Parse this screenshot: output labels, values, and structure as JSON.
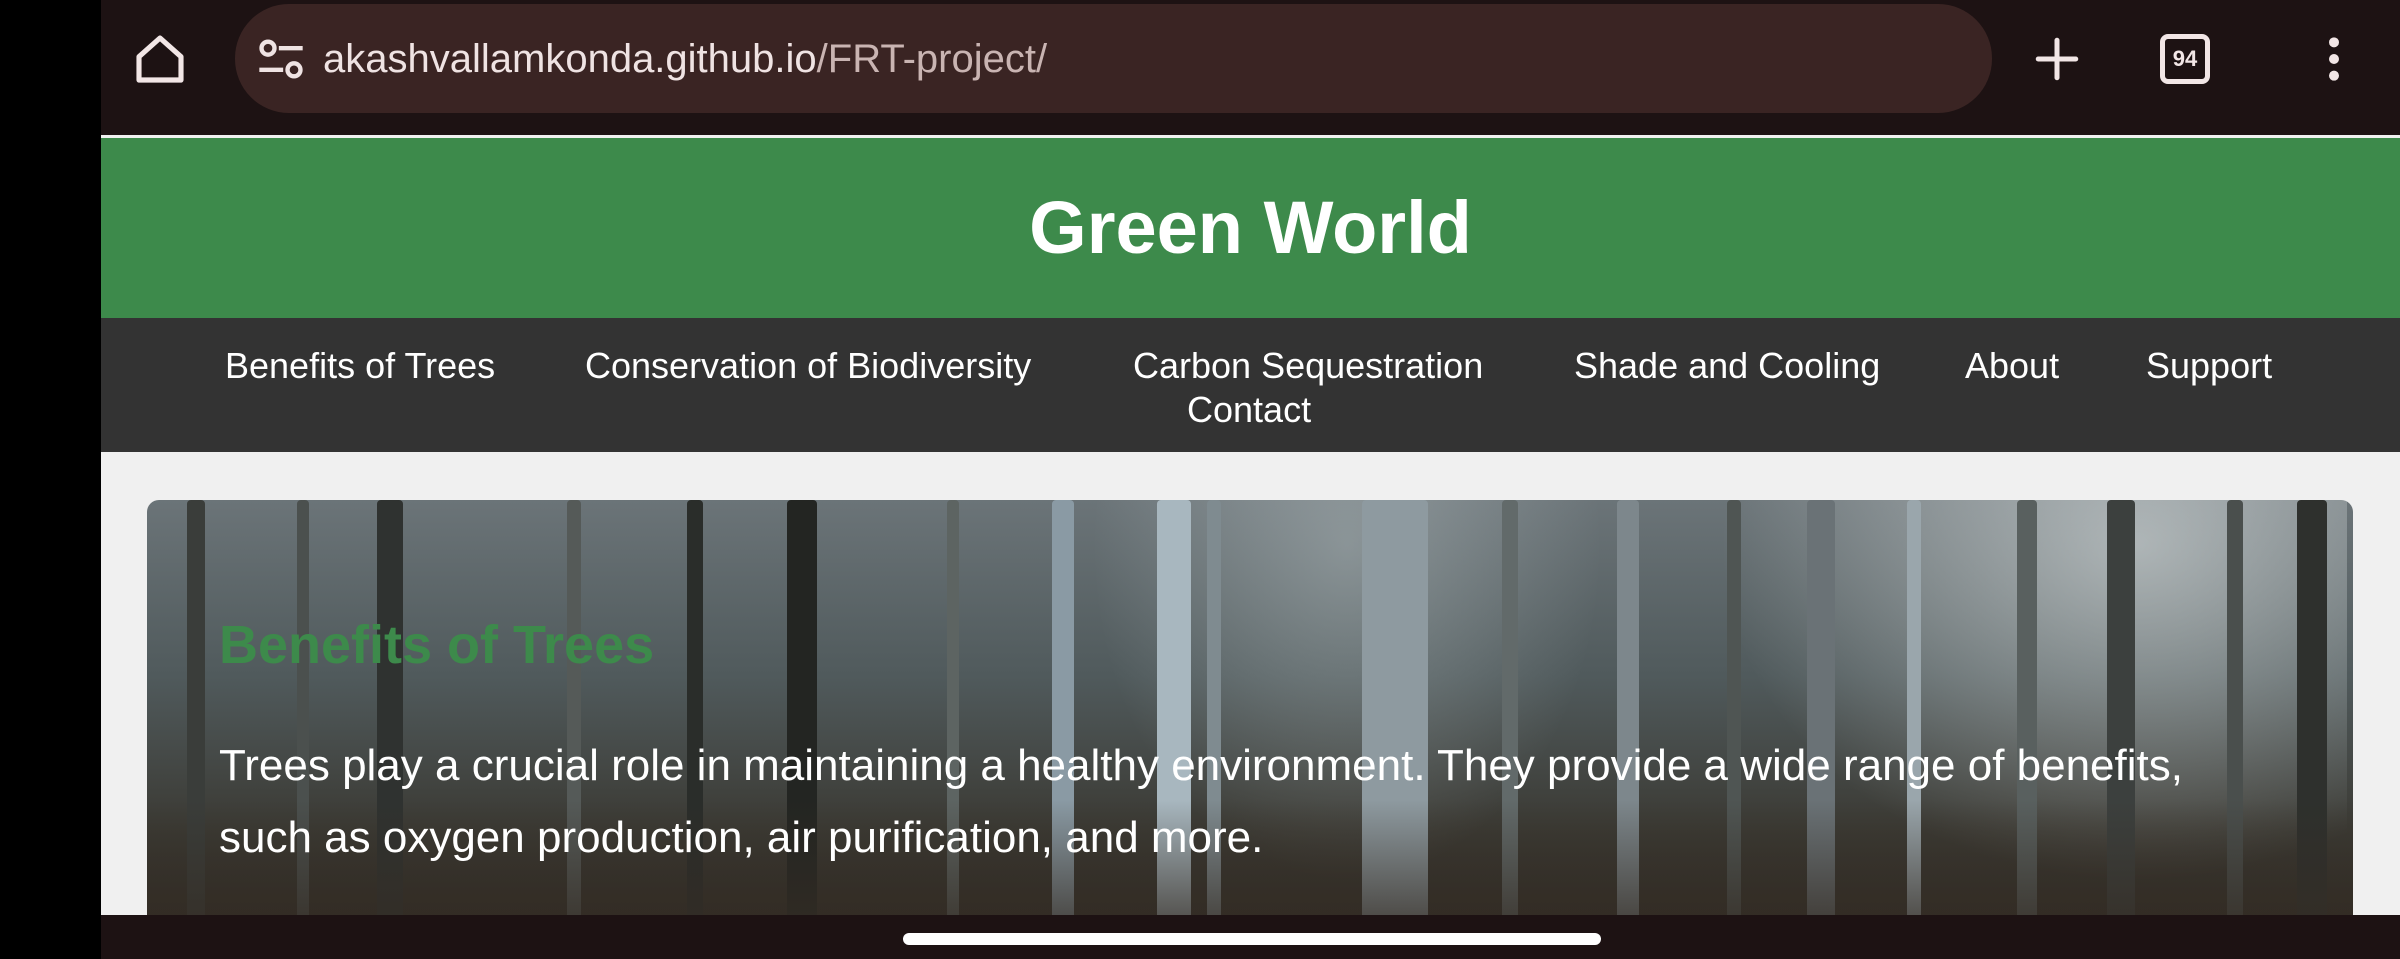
{
  "browser": {
    "url_host": "akashvallamkonda.github.io",
    "url_path": "/FRT-project/",
    "tab_count": "94",
    "icons": {
      "home": "home-icon",
      "site_info": "tune-icon",
      "new_tab": "plus-icon",
      "tabs": "tab-switcher-icon",
      "menu": "more-vert-icon"
    }
  },
  "site": {
    "title": "Green World",
    "nav": [
      "Benefits of Trees",
      "Conservation of Biodiversity",
      "Carbon Sequestration",
      "Shade and Cooling",
      "About",
      "Support",
      "Contact"
    ]
  },
  "hero": {
    "heading": "Benefits of Trees",
    "text": "Trees play a crucial role in maintaining a healthy environment. They provide a wide range of benefits, such as oxygen production, air purification, and more."
  },
  "colors": {
    "chrome_bg": "#1d1213",
    "urlbar_bg": "#3a2423",
    "header_green": "#3d8a4b",
    "nav_bg": "#333333",
    "page_bg": "#f0f0f0"
  }
}
